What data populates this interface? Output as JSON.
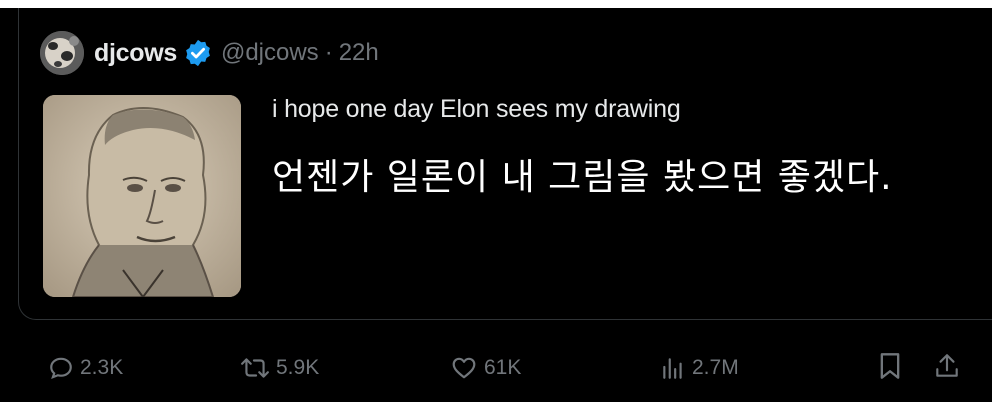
{
  "tweet": {
    "display_name": "djcows",
    "handle": "@djcows",
    "separator": "·",
    "time": "22h",
    "text_en": "i hope one day Elon sees my drawing",
    "text_ko": "언젠가 일론이 내 그림을 봤으면 좋겠다.",
    "verified": true,
    "accent_color": "#1d9bf0"
  },
  "actions": {
    "replies": "2.3K",
    "reposts": "5.9K",
    "likes": "61K",
    "views": "2.7M"
  },
  "icons": {
    "reply": "comment-bubble-icon",
    "repost": "repost-arrows-icon",
    "like": "heart-icon",
    "views": "analytics-bars-icon",
    "bookmark": "bookmark-icon",
    "share": "share-upload-icon"
  }
}
